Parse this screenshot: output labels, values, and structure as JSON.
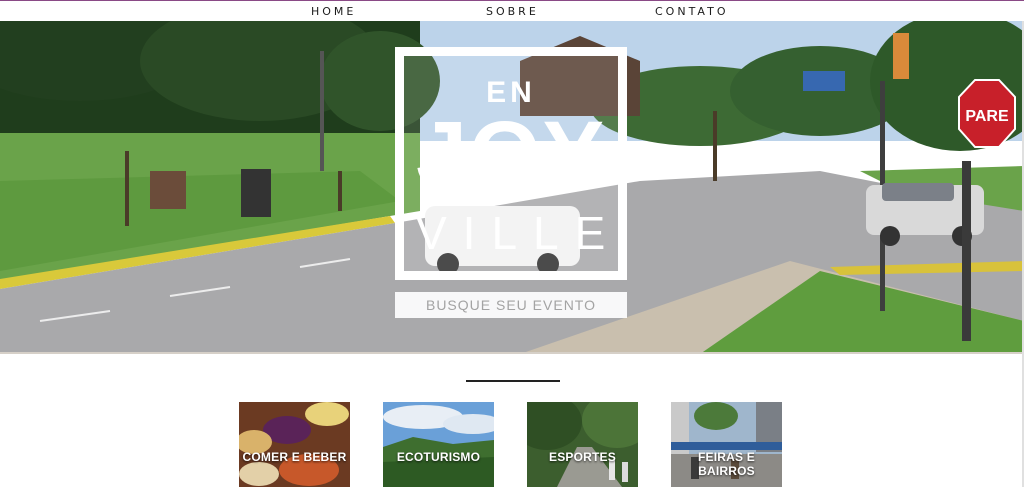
{
  "nav": {
    "items": [
      {
        "label": "HOME"
      },
      {
        "label": "SOBRE"
      },
      {
        "label": "CONTATO"
      }
    ]
  },
  "hero": {
    "logo": {
      "line1": "EN",
      "line2": "JOY",
      "line3": "VILLE"
    },
    "search_button": "BUSQUE SEU EVENTO",
    "sign_text": "PARE"
  },
  "categories": [
    {
      "label": "COMER E BEBER"
    },
    {
      "label": "ECOTURISMO"
    },
    {
      "label": "ESPORTES"
    },
    {
      "label": "FEIRAS E BAIRROS"
    }
  ],
  "colors": {
    "accent_line": "#8a4a86",
    "nav_text": "#1c1c1c",
    "button_text": "#a3a3a3"
  }
}
